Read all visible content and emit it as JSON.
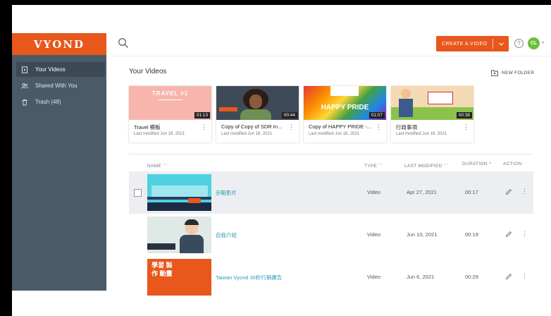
{
  "app": {
    "logo": "VYOND"
  },
  "sidebar": {
    "items": [
      {
        "label": "Your Videos",
        "icon": "video-file-icon",
        "active": true
      },
      {
        "label": "Shared With You",
        "icon": "shared-users-icon",
        "active": false
      },
      {
        "label": "Trash (48)",
        "icon": "trash-icon",
        "active": false
      }
    ]
  },
  "header": {
    "search_icon": "search-icon",
    "create_label": "CREATE A VIDEO",
    "help_label": "?",
    "avatar_initials": "CL",
    "accent_color": "#e8571c"
  },
  "main": {
    "title": "Your Videos",
    "new_folder_label": "NEW FOLDER"
  },
  "cards": [
    {
      "title": "Travel 模板",
      "modified": "Last modified Jun 18, 2021",
      "duration": "01:13",
      "thumb_text": "TRAVEL #1"
    },
    {
      "title": "Copy of Copy of SDR In...",
      "modified": "Last modified Jun 18, 2021",
      "duration": "00:44"
    },
    {
      "title": "Copy of HAPPY PRIDE -...",
      "modified": "Last modified Jun 18, 2021",
      "duration": "01:07",
      "thumb_text": "HAPPY PRIDE"
    },
    {
      "title": "行政事項",
      "modified": "Last modified Jun 16, 2021",
      "duration": "00:38"
    }
  ],
  "table": {
    "headers": {
      "name": "NAME",
      "type": "TYPE",
      "modified": "LAST MODIFIED",
      "duration": "DURATION",
      "action": "ACTION"
    },
    "rows": [
      {
        "name": "示範影片",
        "type": "Video",
        "modified": "Apr 27, 2021",
        "duration": "00:17"
      },
      {
        "name": "自我介紹",
        "type": "Video",
        "modified": "Jun 10, 2021",
        "duration": "00:19"
      },
      {
        "name": "Taiwan Vyond 30秒行銷廣告",
        "type": "Video",
        "modified": "Jun 6, 2021",
        "duration": "00:29",
        "thumb_text": "學習 製作 動畫"
      }
    ]
  }
}
